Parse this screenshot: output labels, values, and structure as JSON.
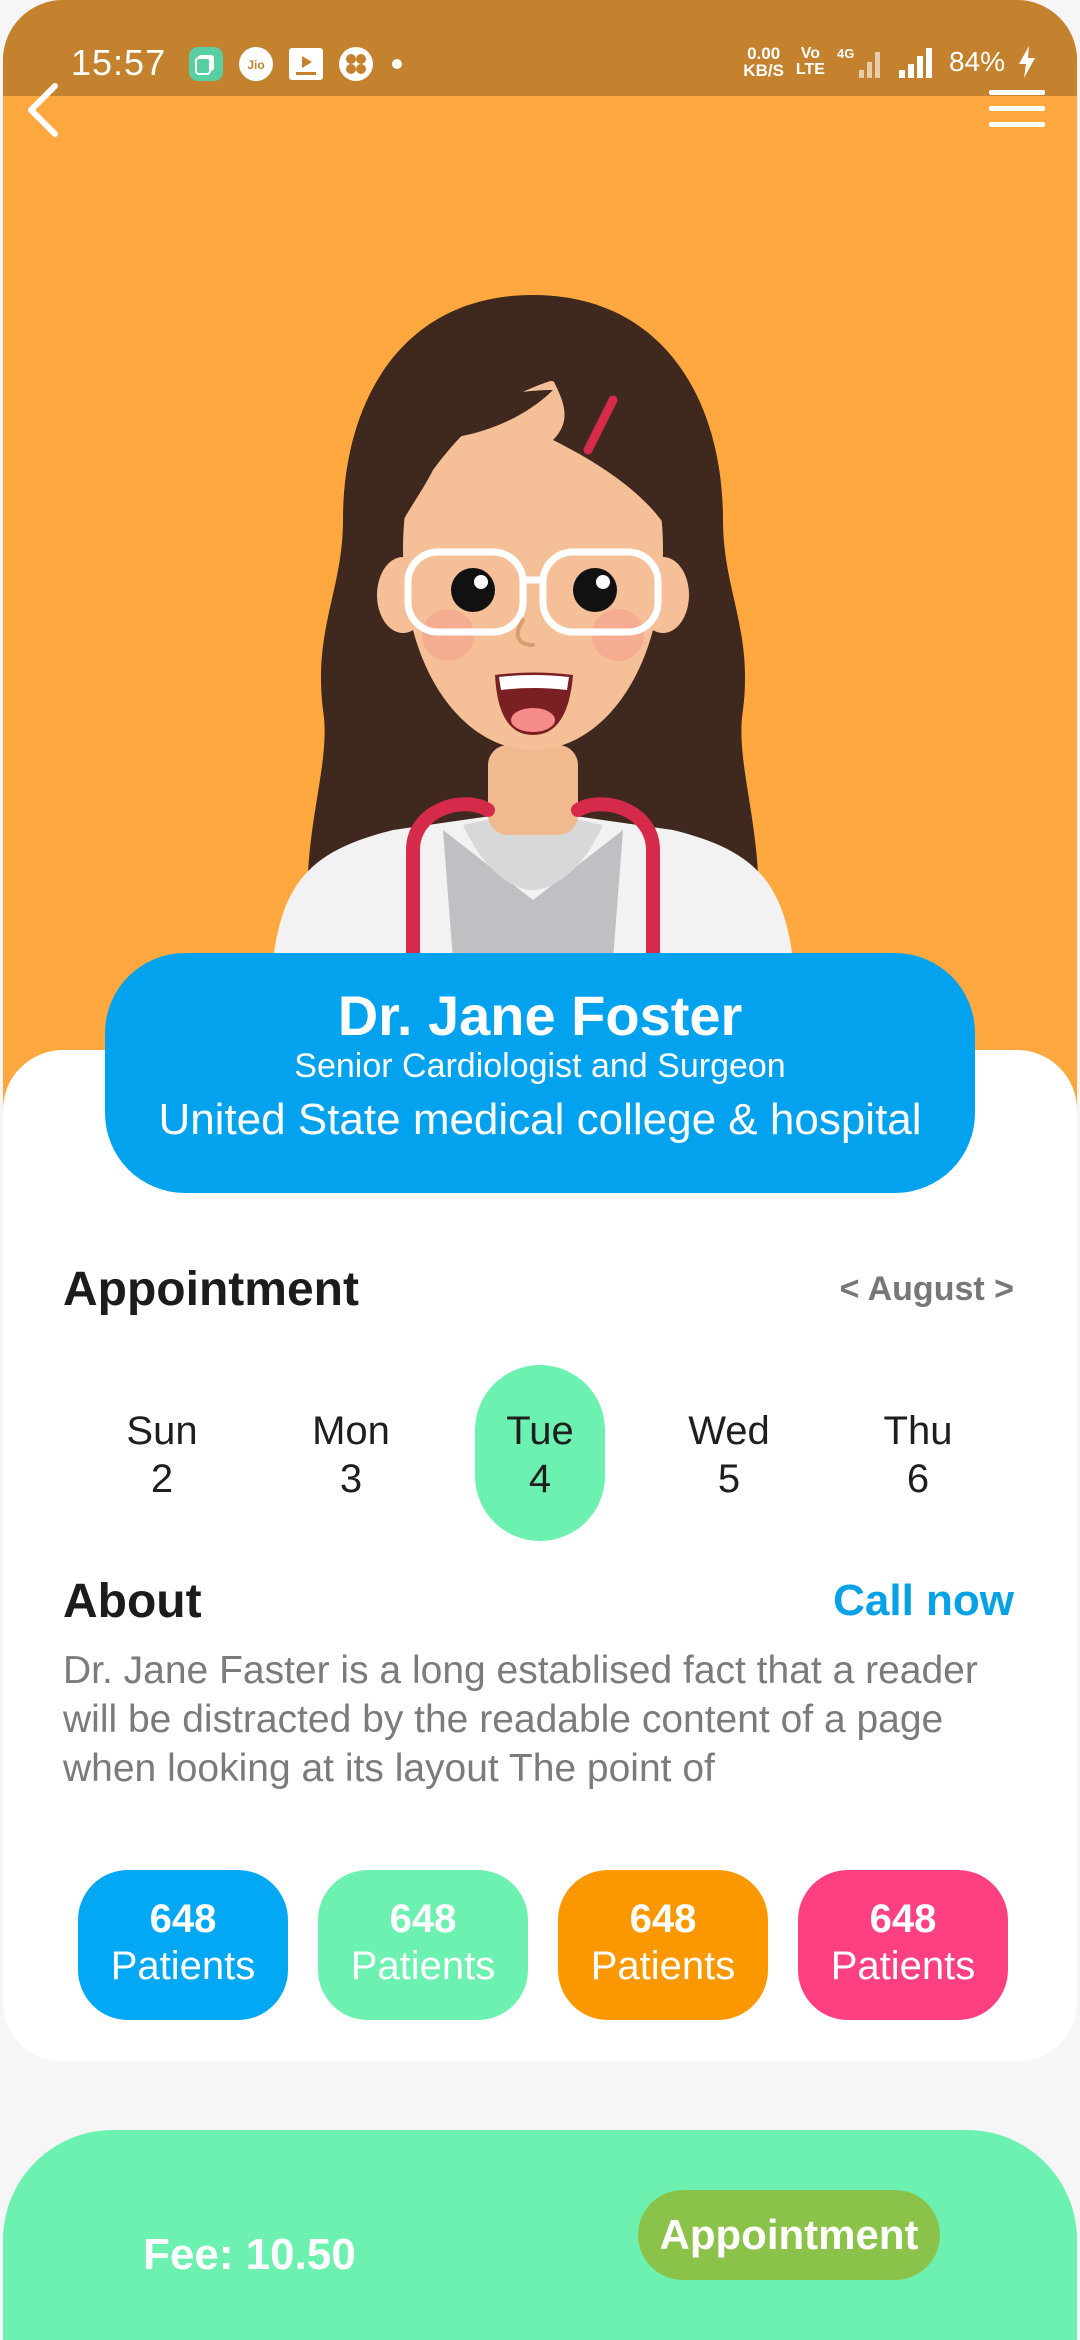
{
  "status_bar": {
    "time": "15:57",
    "net_speed_value": "0.00",
    "net_speed_unit": "KB/S",
    "volte_top": "Vo",
    "volte_bottom": "LTE",
    "network_label": "4G",
    "battery": "84%",
    "icons": [
      "app-notification-icon",
      "jio-icon",
      "media-player-icon",
      "fan-icon"
    ]
  },
  "header": {
    "back_icon": "chevron-left-icon",
    "menu_icon": "hamburger-menu-icon"
  },
  "doctor": {
    "name": "Dr. Jane Foster",
    "title": "Senior Cardiologist and Surgeon",
    "college": "United State medical college & hospital"
  },
  "appointment": {
    "heading": "Appointment",
    "month_nav": "< August >",
    "days": [
      {
        "name": "Sun",
        "date": "2"
      },
      {
        "name": "Mon",
        "date": "3"
      },
      {
        "name": "Tue",
        "date": "4"
      },
      {
        "name": "Wed",
        "date": "5"
      },
      {
        "name": "Thu",
        "date": "6"
      }
    ],
    "selected_day": "Tue"
  },
  "about": {
    "heading": "About",
    "call_now": "Call now",
    "text": "Dr. Jane Faster is a long establised fact that a reader will be distracted by the readable content of a page when looking at its layout The point of"
  },
  "stats": [
    {
      "value": "648",
      "label": "Patients",
      "color": "#02a8f4"
    },
    {
      "value": "648",
      "label": "Patients",
      "color": "#6df1b0"
    },
    {
      "value": "648",
      "label": "Patients",
      "color": "#fb9800"
    },
    {
      "value": "648",
      "label": "Patients",
      "color": "#fe4081"
    }
  ],
  "footer": {
    "fee": "Fee: 10.50",
    "button": "Appointment"
  },
  "colors": {
    "hero_orange": "#ffa83f",
    "status_bar": "#c4822f",
    "profile_blue": "#02a2ee",
    "mint": "#6df1b0",
    "link_blue": "#07a1e5",
    "button_green": "#8bc34a"
  }
}
